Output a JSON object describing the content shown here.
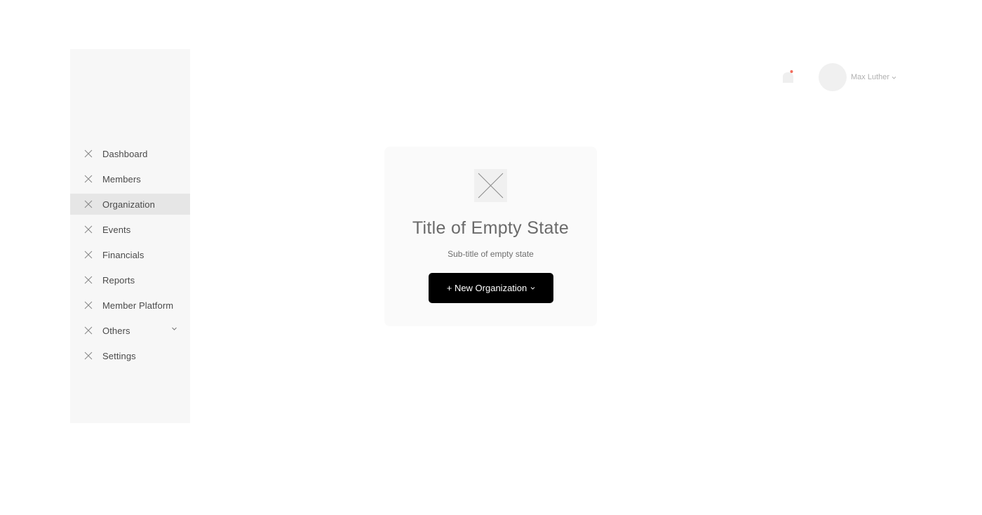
{
  "sidebar": {
    "items": [
      {
        "label": "Dashboard",
        "icon": "placeholder-x-icon",
        "active": false
      },
      {
        "label": "Members",
        "icon": "placeholder-x-icon",
        "active": false
      },
      {
        "label": "Organization",
        "icon": "placeholder-x-icon",
        "active": true
      },
      {
        "label": "Events",
        "icon": "placeholder-x-icon",
        "active": false
      },
      {
        "label": "Financials",
        "icon": "placeholder-x-icon",
        "active": false
      },
      {
        "label": "Reports",
        "icon": "placeholder-x-icon",
        "active": false
      },
      {
        "label": "Member Platform",
        "icon": "placeholder-x-icon",
        "active": false
      },
      {
        "label": "Others",
        "icon": "placeholder-x-icon",
        "active": false,
        "has_dropdown": true
      },
      {
        "label": "Settings",
        "icon": "placeholder-x-icon",
        "active": false
      }
    ]
  },
  "header": {
    "notification_icon": "bell-icon",
    "notification_dot_color": "#f26b5b",
    "user_name": "Max Luther"
  },
  "empty_state": {
    "icon": "placeholder-x-icon",
    "title": "Title of Empty State",
    "subtitle": "Sub-title of empty state",
    "button_label": "+ New Organization"
  },
  "colors": {
    "sidebar_bg": "#f7f7f7",
    "active_item_bg": "#e6e6e6",
    "button_bg": "#000000"
  }
}
